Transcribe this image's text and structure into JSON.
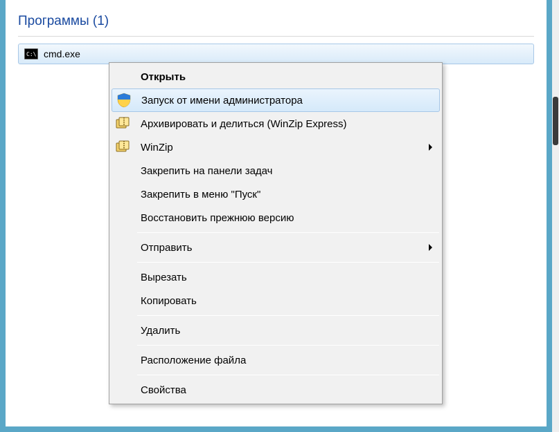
{
  "section": {
    "title": "Программы (1)"
  },
  "result": {
    "label": "cmd.exe"
  },
  "menu": {
    "open": "Открыть",
    "run_admin": "Запуск от имени администратора",
    "winzip_express": "Архивировать и делиться (WinZip Express)",
    "winzip": "WinZip",
    "pin_taskbar": "Закрепить на панели задач",
    "pin_start": "Закрепить в меню \"Пуск\"",
    "restore_prev": "Восстановить прежнюю версию",
    "send_to": "Отправить",
    "cut": "Вырезать",
    "copy": "Копировать",
    "delete": "Удалить",
    "file_location": "Расположение файла",
    "properties": "Свойства"
  }
}
